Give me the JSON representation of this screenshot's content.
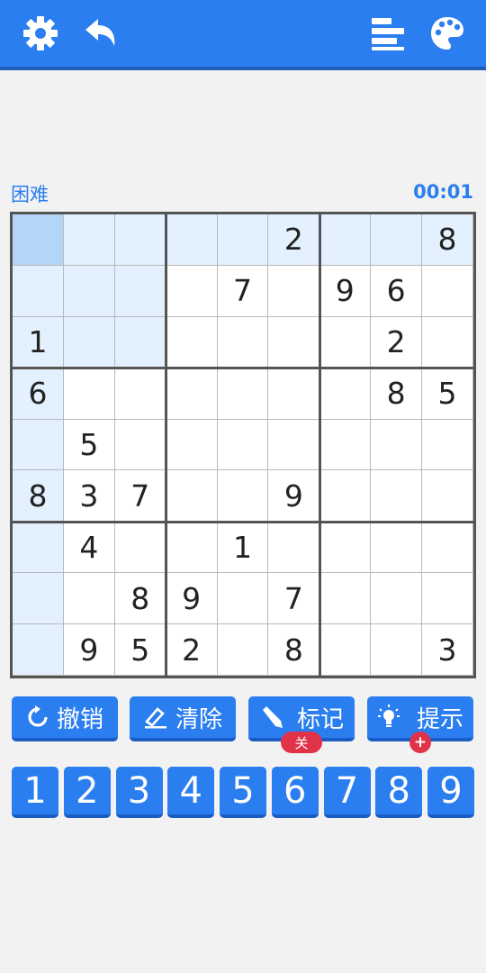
{
  "toolbar": {
    "color": "#2a7ef0",
    "icons": [
      "gear-icon",
      "undo-arrow-icon",
      "stats-bars-icon",
      "palette-icon"
    ]
  },
  "status": {
    "level": "困难",
    "time": "00:01"
  },
  "board": {
    "grid": [
      [
        "",
        "",
        "",
        "",
        "",
        "2",
        "",
        "",
        "8"
      ],
      [
        "",
        "",
        "",
        "",
        "7",
        "",
        "9",
        "6",
        ""
      ],
      [
        "1",
        "",
        "",
        "",
        "",
        "",
        "",
        "2",
        ""
      ],
      [
        "6",
        "",
        "",
        "",
        "",
        "",
        "",
        "8",
        "5"
      ],
      [
        "",
        "5",
        "",
        "",
        "",
        "",
        "",
        "",
        ""
      ],
      [
        "8",
        "3",
        "7",
        "",
        "",
        "9",
        "",
        "",
        ""
      ],
      [
        "",
        "4",
        "",
        "",
        "1",
        "",
        "",
        "",
        ""
      ],
      [
        "",
        "",
        "8",
        "9",
        "",
        "7",
        "",
        "",
        ""
      ],
      [
        "",
        "9",
        "5",
        "2",
        "",
        "8",
        "",
        "",
        "3"
      ]
    ],
    "selected": [
      0,
      0
    ],
    "highlight_color": "#e3f0fd",
    "selected_color": "#b3d5f7"
  },
  "actions": [
    {
      "label": "撤销",
      "icon": "undo-circle-icon"
    },
    {
      "label": "清除",
      "icon": "eraser-icon"
    },
    {
      "label": "标记",
      "icon": "pencil-icon",
      "badge": "关"
    },
    {
      "label": "提示",
      "icon": "lightbulb-icon",
      "badge": "+"
    }
  ],
  "numpad": [
    "1",
    "2",
    "3",
    "4",
    "5",
    "6",
    "7",
    "8",
    "9"
  ],
  "colors": {
    "accent": "#2a7ef0",
    "badge": "#e0334a",
    "background": "#f2f2f2"
  }
}
